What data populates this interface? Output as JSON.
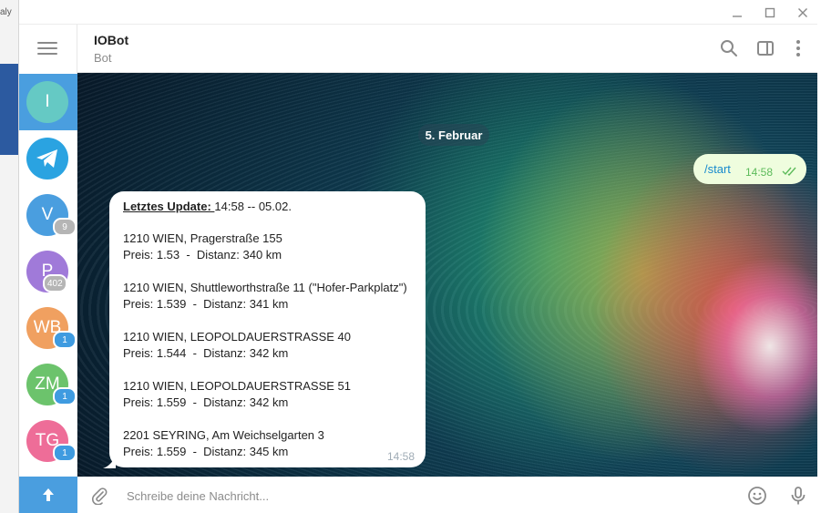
{
  "desktop": {
    "left_text": "aly"
  },
  "window": {
    "controls": {
      "minimize": "—",
      "maximize": "☐",
      "close": "✕"
    }
  },
  "sidebar": {
    "items": [
      {
        "initials": "I",
        "color": "#65c9c4",
        "active": true,
        "badge": ""
      },
      {
        "initials": "",
        "icon": "telegram-icon",
        "color": "#2aa3e1",
        "active": false,
        "badge": ""
      },
      {
        "initials": "V",
        "color": "#4a9edf",
        "active": false,
        "badge": "9",
        "badge_color": "#b5b5b5"
      },
      {
        "initials": "P",
        "color": "#a07ad9",
        "active": false,
        "badge": "402",
        "badge_color": "#b5b5b5"
      },
      {
        "initials": "WB",
        "color": "#f0a060",
        "active": false,
        "badge": "1",
        "badge_color": "#3f9be0"
      },
      {
        "initials": "ZM",
        "color": "#6cc36c",
        "active": false,
        "badge": "1",
        "badge_color": "#3f9be0"
      },
      {
        "initials": "TG",
        "color": "#ee6d98",
        "active": false,
        "badge": "1",
        "badge_color": "#3f9be0"
      }
    ]
  },
  "header": {
    "title": "IOBot",
    "subtitle": "Bot",
    "icons": [
      "search-icon",
      "sidebar-toggle-icon",
      "more-vertical-icon"
    ]
  },
  "chat": {
    "date_separator": "5. Februar",
    "outgoing": {
      "text": "/start",
      "time": "14:58",
      "status": "read"
    },
    "incoming": {
      "header_label": "Letztes Update: ",
      "header_value": " 14:58 -- 05.02.",
      "entries": [
        {
          "address": "1210 WIEN, Pragerstraße 155",
          "price": "Preis: 1.53  -  Distanz: 340 km"
        },
        {
          "address": "1210 WIEN, Shuttleworthstraße 11 (\"Hofer-Parkplatz\")",
          "price": "Preis: 1.539  -  Distanz: 341 km"
        },
        {
          "address": "1210 WIEN, LEOPOLDAUERSTRASSE 40",
          "price": "Preis: 1.544  -  Distanz: 342 km"
        },
        {
          "address": "1210 WIEN, LEOPOLDAUERSTRASSE 51",
          "price": "Preis: 1.559  -  Distanz: 342 km"
        },
        {
          "address": "2201 SEYRING, Am Weichselgarten 3",
          "price": "Preis: 1.559  -  Distanz: 345 km"
        }
      ],
      "time": "14:58"
    }
  },
  "input": {
    "placeholder": "Schreibe deine Nachricht...",
    "value": ""
  },
  "colors": {
    "accent": "#4a9edf",
    "outgoing_bubble": "#effdde",
    "link": "#168acd",
    "read_check": "#5dbb5b"
  }
}
